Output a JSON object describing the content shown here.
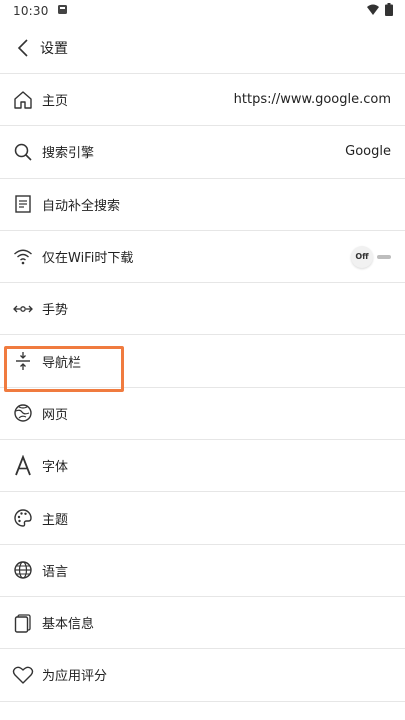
{
  "status_bar": {
    "time": "10:30"
  },
  "header": {
    "title": "设置"
  },
  "rows": [
    {
      "label": "主页",
      "value": "https://www.google.com"
    },
    {
      "label": "搜索引擎",
      "value": "Google"
    },
    {
      "label": "自动补全搜索"
    },
    {
      "label": "仅在WiFi时下载",
      "toggle": "Off"
    },
    {
      "label": "手势"
    },
    {
      "label": "导航栏"
    },
    {
      "label": "网页"
    },
    {
      "label": "字体"
    },
    {
      "label": "主题"
    },
    {
      "label": "语言"
    },
    {
      "label": "基本信息"
    },
    {
      "label": "为应用评分"
    }
  ],
  "colors": {
    "highlight": "#f07b3f",
    "divider": "#e6e6e6",
    "text": "#222222"
  }
}
